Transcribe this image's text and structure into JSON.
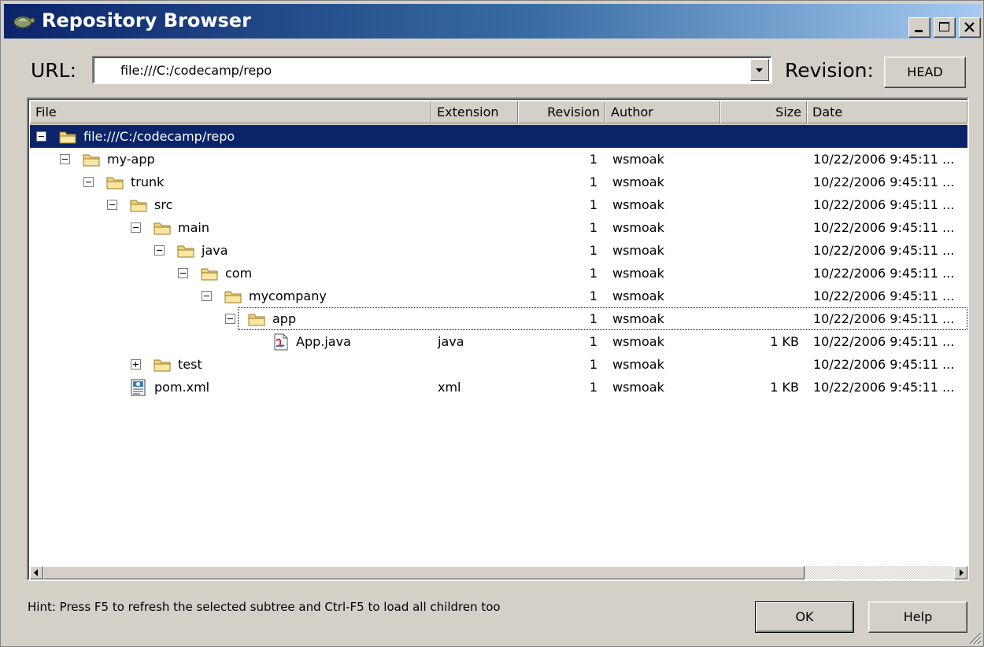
{
  "window": {
    "title": "Repository Browser",
    "controls": {
      "minimize": "minimize-icon",
      "maximize": "maximize-icon",
      "close": "close-icon"
    }
  },
  "toolbar": {
    "url_label": "URL:",
    "url_value": "file:///C:/codecamp/repo",
    "revision_label": "Revision:",
    "revision_button": "HEAD"
  },
  "columns": [
    "File",
    "Extension",
    "Revision",
    "Author",
    "Size",
    "Date"
  ],
  "rows": [
    {
      "name": "file:///C:/codecamp/repo",
      "ext": "",
      "rev": "",
      "author": "",
      "size": "",
      "date": "",
      "icon": "folder-icon",
      "expander": "minus"
    },
    {
      "name": "my-app",
      "ext": "",
      "rev": "1",
      "author": "wsmoak",
      "size": "",
      "date": "10/22/2006 9:45:11 ...",
      "icon": "folder-icon",
      "expander": "minus"
    },
    {
      "name": "trunk",
      "ext": "",
      "rev": "1",
      "author": "wsmoak",
      "size": "",
      "date": "10/22/2006 9:45:11 ...",
      "icon": "folder-icon",
      "expander": "minus"
    },
    {
      "name": "src",
      "ext": "",
      "rev": "1",
      "author": "wsmoak",
      "size": "",
      "date": "10/22/2006 9:45:11 ...",
      "icon": "folder-icon",
      "expander": "minus"
    },
    {
      "name": "main",
      "ext": "",
      "rev": "1",
      "author": "wsmoak",
      "size": "",
      "date": "10/22/2006 9:45:11 ...",
      "icon": "folder-icon",
      "expander": "minus"
    },
    {
      "name": "java",
      "ext": "",
      "rev": "1",
      "author": "wsmoak",
      "size": "",
      "date": "10/22/2006 9:45:11 ...",
      "icon": "folder-icon",
      "expander": "minus"
    },
    {
      "name": "com",
      "ext": "",
      "rev": "1",
      "author": "wsmoak",
      "size": "",
      "date": "10/22/2006 9:45:11 ...",
      "icon": "folder-icon",
      "expander": "minus"
    },
    {
      "name": "mycompany",
      "ext": "",
      "rev": "1",
      "author": "wsmoak",
      "size": "",
      "date": "10/22/2006 9:45:11 ...",
      "icon": "folder-icon",
      "expander": "minus"
    },
    {
      "name": "app",
      "ext": "",
      "rev": "1",
      "author": "wsmoak",
      "size": "",
      "date": "10/22/2006 9:45:11 ...",
      "icon": "folder-icon",
      "expander": "minus"
    },
    {
      "name": "App.java",
      "ext": "java",
      "rev": "1",
      "author": "wsmoak",
      "size": "1 KB",
      "date": "10/22/2006 9:45:11 ...",
      "icon": "java-file-icon",
      "expander": ""
    },
    {
      "name": "test",
      "ext": "",
      "rev": "1",
      "author": "wsmoak",
      "size": "",
      "date": "10/22/2006 9:45:11 ...",
      "icon": "folder-icon",
      "expander": "plus"
    },
    {
      "name": "pom.xml",
      "ext": "xml",
      "rev": "1",
      "author": "wsmoak",
      "size": "1 KB",
      "date": "10/22/2006 9:45:11 ...",
      "icon": "xml-file-icon",
      "expander": ""
    }
  ],
  "hint": "Hint: Press F5 to refresh the selected subtree and Ctrl-F5 to load all children too",
  "buttons": {
    "ok": "OK",
    "help": "Help"
  },
  "colors": {
    "title_start": "#0a246a",
    "title_end": "#a6caf0",
    "selection": "#0a246a",
    "face": "#d4d0c8"
  }
}
